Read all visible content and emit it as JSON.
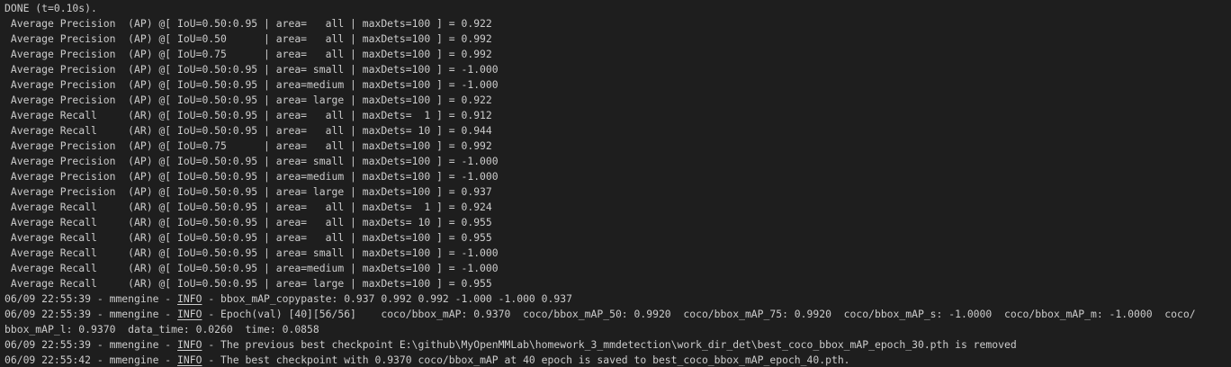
{
  "terminal": {
    "done_line": "DONE (t=0.10s).",
    "metrics_a": [
      " Average Precision  (AP) @[ IoU=0.50:0.95 | area=   all | maxDets=100 ] = 0.922",
      " Average Precision  (AP) @[ IoU=0.50      | area=   all | maxDets=100 ] = 0.992",
      " Average Precision  (AP) @[ IoU=0.75      | area=   all | maxDets=100 ] = 0.992",
      " Average Precision  (AP) @[ IoU=0.50:0.95 | area= small | maxDets=100 ] = -1.000",
      " Average Precision  (AP) @[ IoU=0.50:0.95 | area=medium | maxDets=100 ] = -1.000",
      " Average Precision  (AP) @[ IoU=0.50:0.95 | area= large | maxDets=100 ] = 0.922",
      " Average Recall     (AR) @[ IoU=0.50:0.95 | area=   all | maxDets=  1 ] = 0.912",
      " Average Recall     (AR) @[ IoU=0.50:0.95 | area=   all | maxDets= 10 ] = 0.944"
    ],
    "metrics_b": [
      " Average Precision  (AP) @[ IoU=0.75      | area=   all | maxDets=100 ] = 0.992",
      " Average Precision  (AP) @[ IoU=0.50:0.95 | area= small | maxDets=100 ] = -1.000",
      " Average Precision  (AP) @[ IoU=0.50:0.95 | area=medium | maxDets=100 ] = -1.000",
      " Average Precision  (AP) @[ IoU=0.50:0.95 | area= large | maxDets=100 ] = 0.937",
      " Average Recall     (AR) @[ IoU=0.50:0.95 | area=   all | maxDets=  1 ] = 0.924",
      " Average Recall     (AR) @[ IoU=0.50:0.95 | area=   all | maxDets= 10 ] = 0.955",
      " Average Recall     (AR) @[ IoU=0.50:0.95 | area=   all | maxDets=100 ] = 0.955",
      " Average Recall     (AR) @[ IoU=0.50:0.95 | area= small | maxDets=100 ] = -1.000",
      " Average Recall     (AR) @[ IoU=0.50:0.95 | area=medium | maxDets=100 ] = -1.000",
      " Average Recall     (AR) @[ IoU=0.50:0.95 | area= large | maxDets=100 ] = 0.955"
    ],
    "log_prefix_1": "06/09 22:55:39 - mmengine - ",
    "log_prefix_2": "06/09 22:55:39 - mmengine - ",
    "log_prefix_3": "06/09 22:55:39 - mmengine - ",
    "log_prefix_4": "06/09 22:55:42 - mmengine - ",
    "info_label": "INFO",
    "log_msg_1": " - bbox_mAP_copypaste: 0.937 0.992 0.992 -1.000 -1.000 0.937",
    "log_msg_2": " - Epoch(val) [40][56/56]    coco/bbox_mAP: 0.9370  coco/bbox_mAP_50: 0.9920  coco/bbox_mAP_75: 0.9920  coco/bbox_mAP_s: -1.0000  coco/bbox_mAP_m: -1.0000  coco/",
    "log_msg_2_cont": "bbox_mAP_l: 0.9370  data_time: 0.0260  time: 0.0858",
    "log_msg_3": " - The previous best checkpoint E:\\github\\MyOpenMMLab\\homework_3_mmdetection\\work_dir_det\\best_coco_bbox_mAP_epoch_30.pth is removed",
    "log_msg_4": " - The best checkpoint with 0.9370 coco/bbox_mAP at 40 epoch is saved to best_coco_bbox_mAP_epoch_40.pth.",
    "colors": {
      "background": "#1e1e1e",
      "text": "#cccccc"
    }
  }
}
